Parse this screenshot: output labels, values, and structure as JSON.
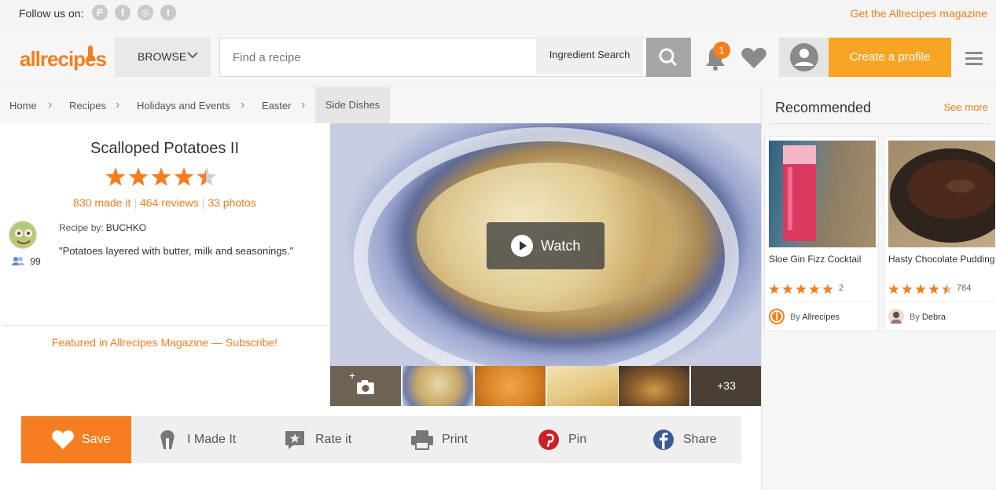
{
  "topbar": {
    "follow_label": "Follow us on:",
    "social_icons": [
      "pinterest-icon",
      "facebook-icon",
      "instagram-icon",
      "twitter-icon"
    ],
    "magazine_link": "Get the Allrecipes magazine"
  },
  "header": {
    "logo_text": "allrecipes",
    "browse_label": "BROWSE",
    "search_placeholder": "Find a recipe",
    "ingredient_search_label": "Ingredient Search",
    "notification_count": "1",
    "create_profile_label": "Create a profile"
  },
  "breadcrumb": [
    "Home",
    "Recipes",
    "Holidays and Events",
    "Easter",
    "Side Dishes"
  ],
  "recipe": {
    "title": "Scalloped Potatoes II",
    "rating": 4.5,
    "made_it": "830 made it",
    "reviews": "464 reviews",
    "photos": "33 photos",
    "recipe_by_label": "Recipe by:",
    "author": "BUCHKO",
    "followers": "99",
    "description": "\"Potatoes layered with butter, milk and seasonings.\"",
    "featured": "Featured in Allrecipes Magazine — Subscribe!"
  },
  "media": {
    "watch_label": "Watch",
    "more_photos": "+33"
  },
  "actions": {
    "save": "Save",
    "made_it": "I Made It",
    "rate": "Rate it",
    "print": "Print",
    "pin": "Pin",
    "share": "Share"
  },
  "recommended": {
    "title": "Recommended",
    "see_more": "See more",
    "cards": [
      {
        "name": "Sloe Gin Fizz Cocktail",
        "rating": 5,
        "count": "2",
        "by_label": "By",
        "by": "Allrecipes"
      },
      {
        "name": "Hasty Chocolate Pudding",
        "rating": 4.5,
        "count": "784",
        "by_label": "By",
        "by": "Debra"
      }
    ]
  },
  "colors": {
    "accent": "#f47e20",
    "create_profile": "#f7a523",
    "star": "#f47e20"
  }
}
